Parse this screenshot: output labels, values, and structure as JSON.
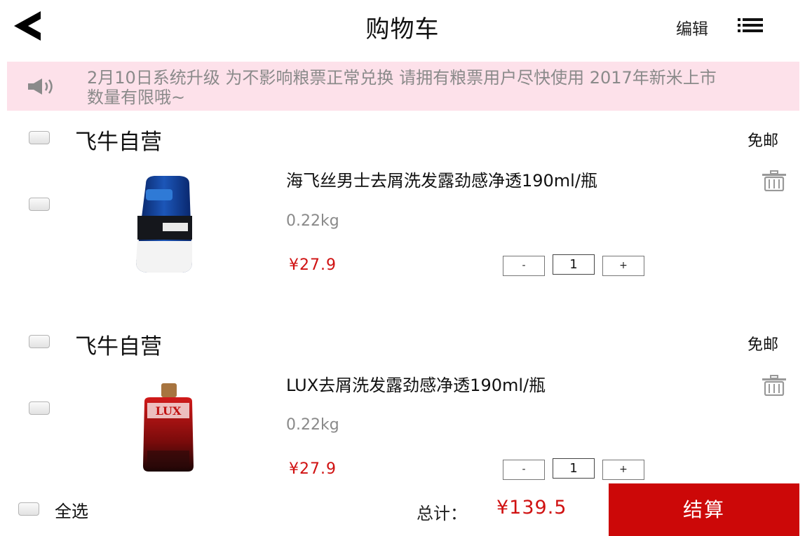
{
  "header": {
    "title": "购物车",
    "edit_label": "编辑",
    "back_icon": "chevron-left-icon",
    "list_icon": "list-icon"
  },
  "notice": {
    "icon": "speaker-icon",
    "text": "2月10日系统升级 为不影响粮票正常兑换 请拥有粮票用户尽快使用 2017年新米上市数量有限哦~"
  },
  "stores": [
    {
      "name": "飞牛自营",
      "shipping": "免邮",
      "product": {
        "name": "海飞丝男士去屑洗发露劲感净透190ml/瓶",
        "weight": "0.22kg",
        "price": "¥27.9",
        "qty_minus": "-",
        "qty": "1",
        "qty_plus": "+"
      }
    },
    {
      "name": "飞牛自营",
      "shipping": "免邮",
      "product": {
        "name": "LUX去屑洗发露劲感净透190ml/瓶",
        "weight": "0.22kg",
        "price": "¥27.9",
        "qty_minus": "-",
        "qty": "1",
        "qty_plus": "+"
      }
    }
  ],
  "footer": {
    "select_all_label": "全选",
    "total_label": "总计：",
    "total_value": "¥139.5",
    "checkout_label": "结算"
  },
  "colors": {
    "accent": "#cc0808",
    "price": "#d01111",
    "notice_bg": "#fde1ea"
  }
}
